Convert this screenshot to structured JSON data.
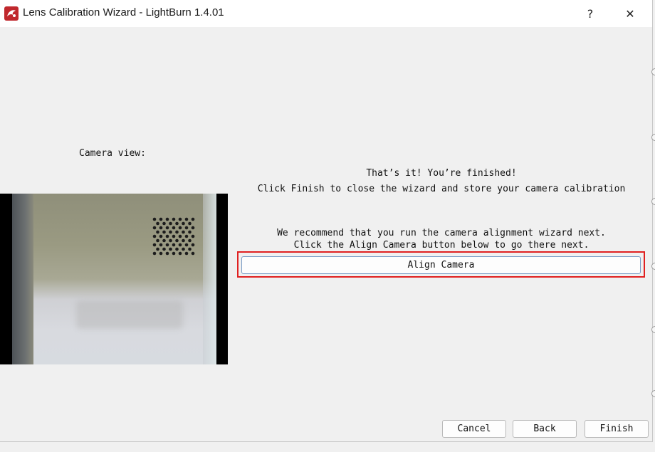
{
  "window": {
    "title": "Lens Calibration Wizard - LightBurn 1.4.01",
    "help_label": "?",
    "close_label": "✕",
    "app_icon": "lightburn-logo-icon"
  },
  "left_panel": {
    "camera_label": "Camera view:"
  },
  "main": {
    "finished_line1": "That’s it!  You’re finished!",
    "finished_line2": "Click Finish to close the wizard and store your camera calibration",
    "recommend_line1": "We recommend that you run the camera alignment wizard next.",
    "recommend_line2": "Click the Align Camera button below to go there next.",
    "align_button_label": "Align Camera"
  },
  "footer": {
    "cancel_label": "Cancel",
    "back_label": "Back",
    "finish_label": "Finish"
  },
  "colors": {
    "highlight_border": "#e02020",
    "background": "#f0f0f0",
    "accent_border": "#7a9cc6"
  }
}
